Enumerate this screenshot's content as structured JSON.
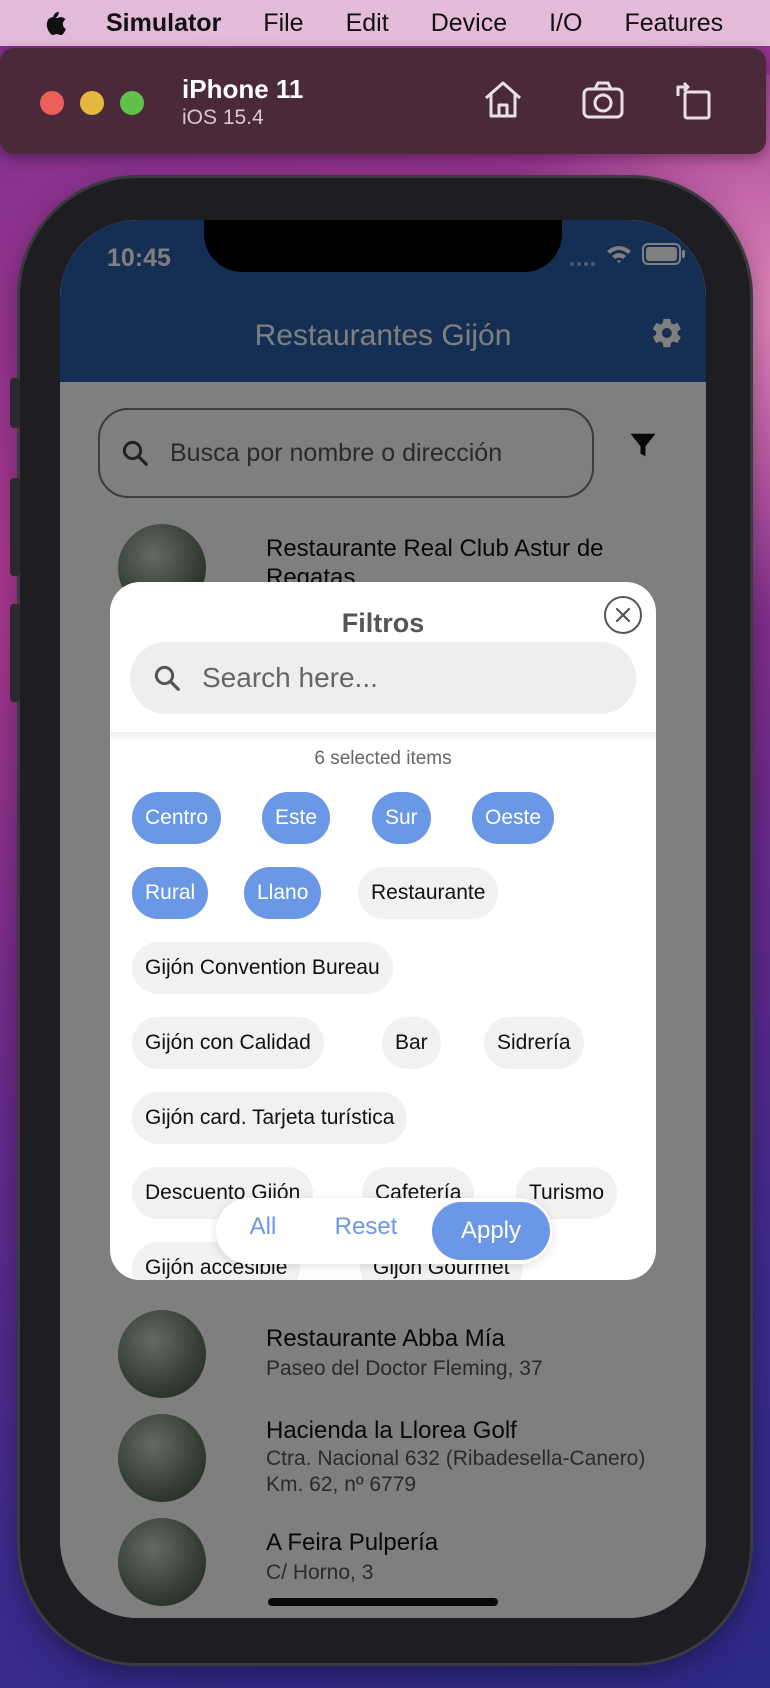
{
  "menubar": {
    "items": [
      "Simulator",
      "File",
      "Edit",
      "Device",
      "I/O",
      "Features"
    ]
  },
  "simulator": {
    "device_name": "iPhone 11",
    "os_version": "iOS 15.4"
  },
  "statusbar": {
    "time": "10:45"
  },
  "appbar": {
    "title": "Restaurantes Gijón"
  },
  "search": {
    "placeholder": "Busca por nombre o dirección"
  },
  "restaurants": [
    {
      "name": "Restaurante Real Club Astur de Regatas",
      "address": ""
    },
    {
      "name": "Restaurante Abba Mía",
      "address": "Paseo del Doctor Fleming, 37"
    },
    {
      "name": "Hacienda la Llorea Golf",
      "address": "Ctra. Nacional 632 (Ribadesella-Canero) Km. 62, nº 6779"
    },
    {
      "name": "A Feira Pulpería",
      "address": "C/ Horno, 3"
    }
  ],
  "filter_dialog": {
    "title": "Filtros",
    "search_placeholder": "Search here...",
    "selected_count_text": "6 selected items",
    "chips": [
      {
        "label": "Centro",
        "selected": true
      },
      {
        "label": "Este",
        "selected": true
      },
      {
        "label": "Sur",
        "selected": true
      },
      {
        "label": "Oeste",
        "selected": true
      },
      {
        "label": "Rural",
        "selected": true
      },
      {
        "label": "Llano",
        "selected": true
      },
      {
        "label": "Restaurante",
        "selected": false
      },
      {
        "label": "Gijón Convention Bureau",
        "selected": false
      },
      {
        "label": "Gijón con Calidad",
        "selected": false
      },
      {
        "label": "Bar",
        "selected": false
      },
      {
        "label": "Sidrería",
        "selected": false
      },
      {
        "label": "Gijón card. Tarjeta turística",
        "selected": false
      },
      {
        "label": "Descuento Gijón",
        "selected": false
      },
      {
        "label": "Cafetería",
        "selected": false
      },
      {
        "label": "Turismo",
        "selected": false
      },
      {
        "label": "Gijón accesible",
        "selected": false
      },
      {
        "label": "Gijón Gourmet",
        "selected": false
      }
    ],
    "actions": {
      "all": "All",
      "reset": "Reset",
      "apply": "Apply"
    }
  },
  "colors": {
    "appbar": "#2a5ea8",
    "chip_selected": "#6a97e6",
    "chip_unselected": "#f1f1f1"
  }
}
